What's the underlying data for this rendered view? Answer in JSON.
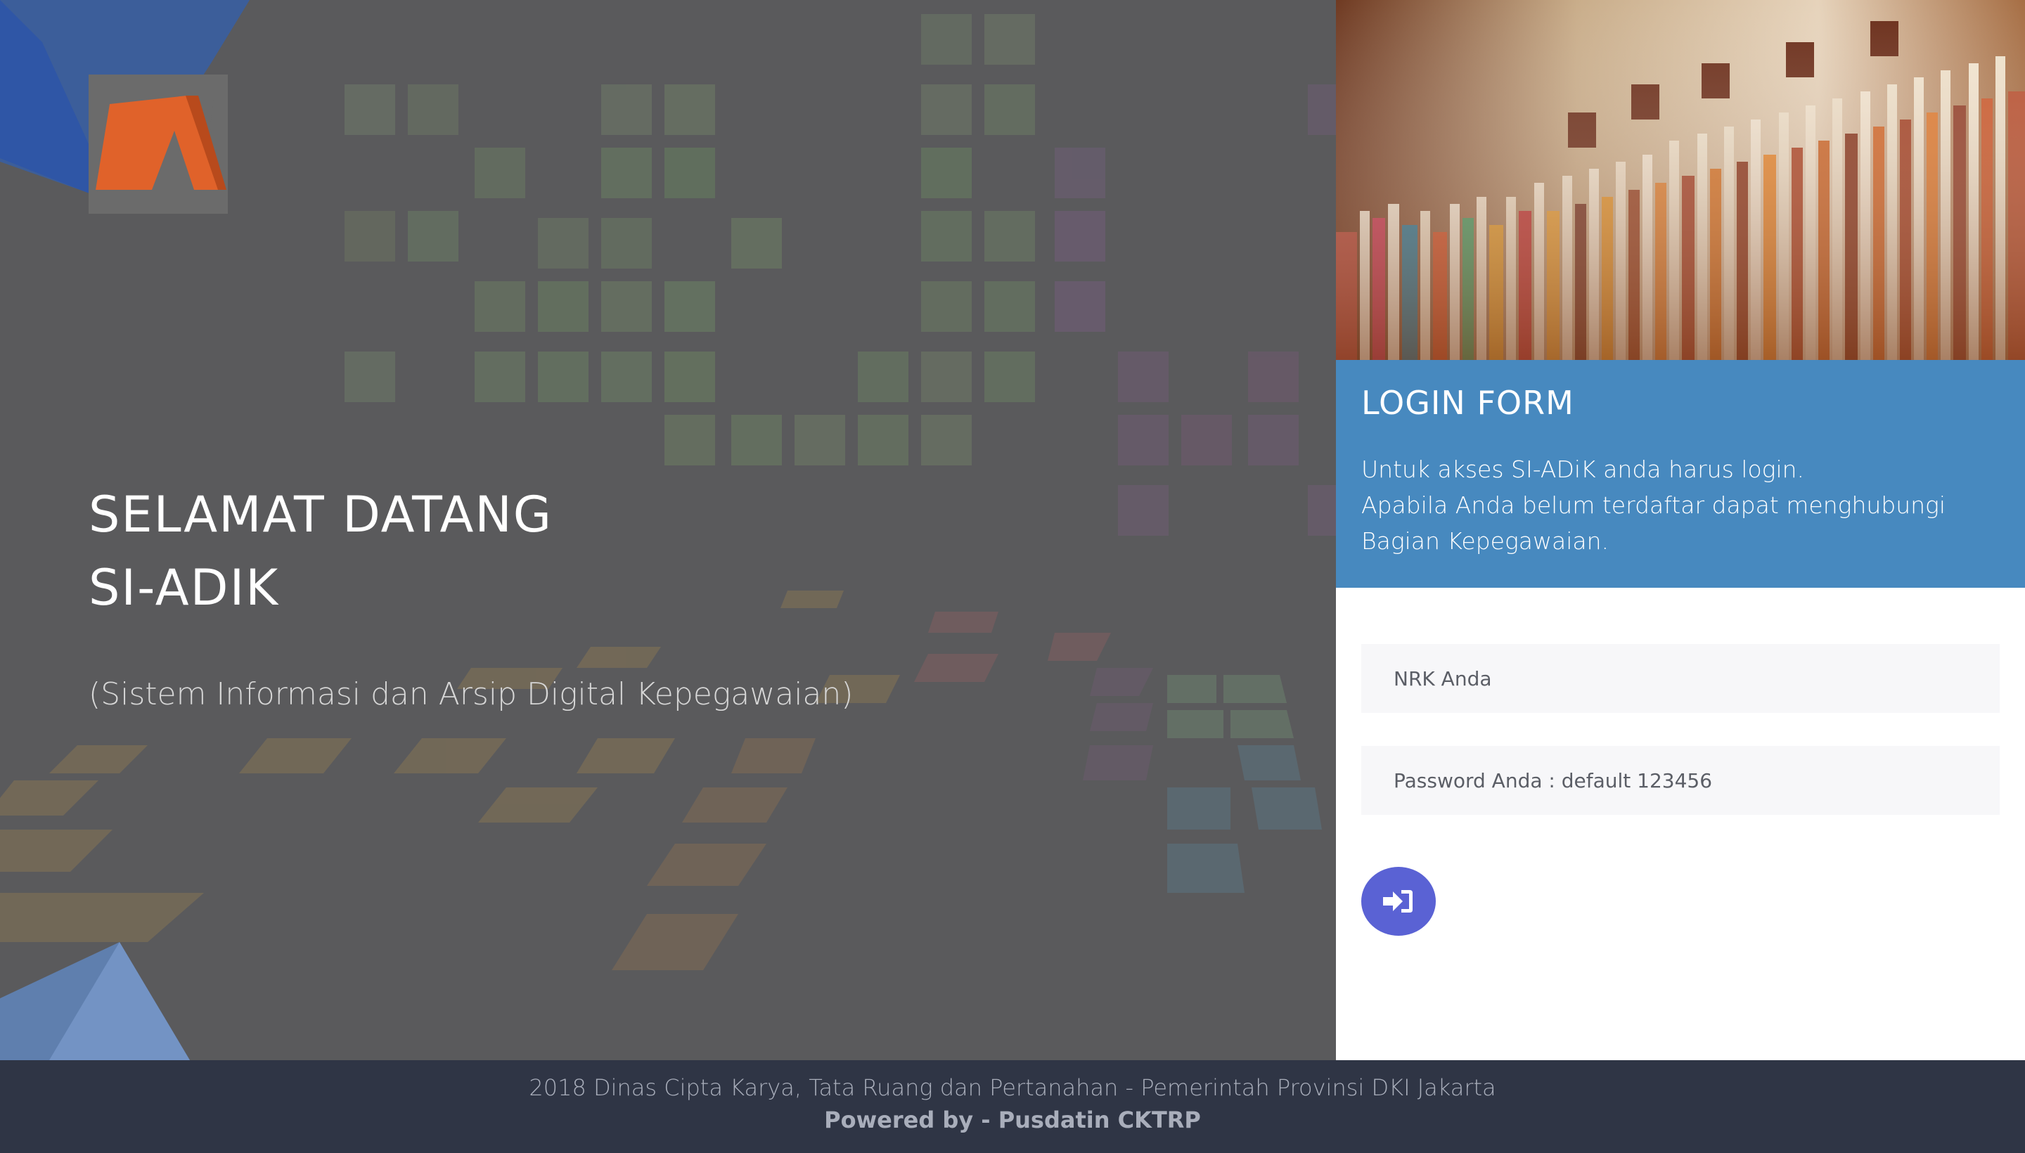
{
  "welcome": {
    "line1": "SELAMAT DATANG",
    "line2": "SI-ADIK",
    "subtitle": "(Sistem Informasi dan Arsip Digital Kepegawaian)"
  },
  "logo": {
    "icon": "archive-a-logo-icon",
    "color": "#e0622a"
  },
  "login": {
    "title": "LOGIN FORM",
    "desc_line1": "Untuk akses SI-ADiK anda harus login.",
    "desc_line2": "Apabila Anda belum terdaftar dapat menghubungi",
    "desc_line3": "Bagian Kepegawaian.",
    "nrk_placeholder": "NRK Anda",
    "password_placeholder": "Password Anda : default 123456",
    "submit_icon": "sign-in-icon"
  },
  "footer": {
    "line1": "2018 Dinas Cipta Karya, Tata Ruang dan Pertanahan - Pemerintah Provinsi DKI Jakarta",
    "line2": "Powered by - Pusdatin CKTRP"
  },
  "colors": {
    "login_header": "#4789bf",
    "submit_button": "#5a62d4",
    "footer": "#2f3545",
    "left_panel": "#5a5a5c"
  }
}
